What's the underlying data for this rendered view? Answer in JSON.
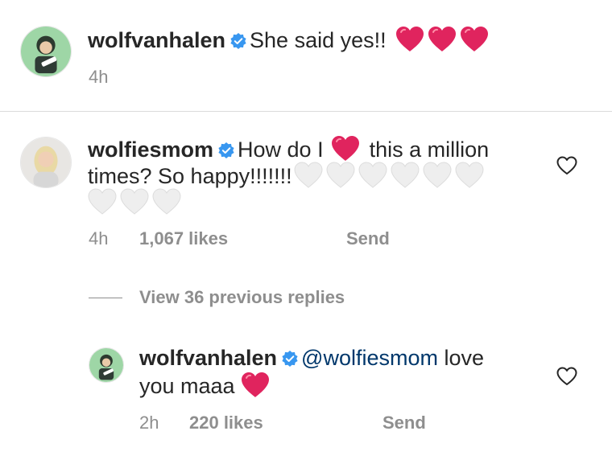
{
  "post": {
    "username": "wolfvanhalen",
    "caption": "She said yes!!",
    "time": "4h"
  },
  "comment": {
    "username": "wolfiesmom",
    "text_part1": "How do I",
    "text_part2": "this a million",
    "text_line2": "times? So happy!!!!!!!",
    "time": "4h",
    "likes": "1,067 likes",
    "send": "Send",
    "view_replies": "View 36 previous replies"
  },
  "reply": {
    "username": "wolfvanhalen",
    "mention": "@wolfiesmom",
    "text_part1": "love",
    "text_line2": "you maaa",
    "time": "2h",
    "likes": "220 likes",
    "send": "Send"
  },
  "colors": {
    "verified": "#3897f0",
    "red_heart": "#e0245e",
    "white_heart": "#eeeeee",
    "muted": "#8e8e8e",
    "mention": "#00376b"
  },
  "icons": {
    "verified": "verified-badge-icon",
    "red_heart": "red-heart-emoji",
    "white_heart": "white-heart-emoji",
    "like": "heart-outline-icon"
  }
}
